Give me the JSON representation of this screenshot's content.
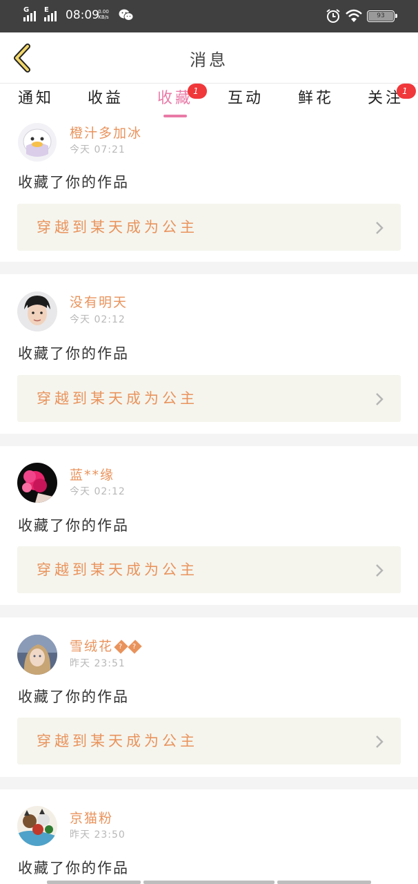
{
  "status_bar": {
    "net1": "G",
    "net2": "E",
    "time": "08:09",
    "speed_value": "0.00",
    "speed_unit": "KB/s",
    "battery": "93"
  },
  "header": {
    "title": "消息"
  },
  "tabs": [
    {
      "label": "通知",
      "badge": ""
    },
    {
      "label": "收益",
      "badge": ""
    },
    {
      "label": "收藏",
      "badge": "1"
    },
    {
      "label": "互动",
      "badge": ""
    },
    {
      "label": "鲜花",
      "badge": ""
    },
    {
      "label": "关注",
      "badge": "1"
    }
  ],
  "active_tab": "收藏",
  "colors": {
    "accent_pink": "#e97aa7",
    "accent_orange": "#e9935c",
    "badge_red": "#f0373a"
  },
  "items": [
    {
      "name": "橙汁多加冰",
      "time": "今天 07:21",
      "action": "收藏了你的作品",
      "work": "穿越到某天成为公主",
      "avatar": "white-duck-avatar"
    },
    {
      "name": "没有明天",
      "time": "今天 02:12",
      "action": "收藏了你的作品",
      "work": "穿越到某天成为公主",
      "avatar": "boy-portrait-avatar"
    },
    {
      "name": "蓝**缘",
      "time": "今天 02:12",
      "action": "收藏了你的作品",
      "work": "穿越到某天成为公主",
      "avatar": "pink-flower-avatar"
    },
    {
      "name": "雪绒花",
      "name_suffix": "??",
      "time": "昨天 23:51",
      "action": "收藏了你的作品",
      "work": "穿越到某天成为公主",
      "avatar": "girl-portrait-avatar"
    },
    {
      "name": "京猫粉",
      "time": "昨天 23:50",
      "action": "收藏了你的作品",
      "work": "",
      "avatar": "cats-collage-avatar"
    }
  ]
}
